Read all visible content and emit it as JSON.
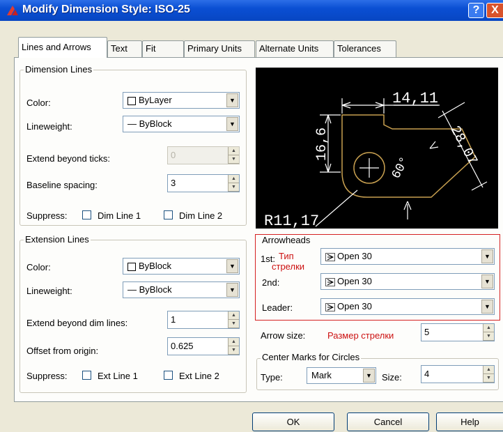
{
  "window": {
    "title": "Modify Dimension Style: ISO-25",
    "help_glyph": "?",
    "close_glyph": "X"
  },
  "tabs": [
    {
      "label": "Lines and Arrows"
    },
    {
      "label": "Text"
    },
    {
      "label": "Fit"
    },
    {
      "label": "Primary Units"
    },
    {
      "label": "Alternate Units"
    },
    {
      "label": "Tolerances"
    }
  ],
  "dimension_lines": {
    "legend": "Dimension Lines",
    "color_label": "Color:",
    "color_value": "ByLayer",
    "lineweight_label": "Lineweight:",
    "lineweight_value": "ByBlock",
    "extend_ticks_label": "Extend beyond ticks:",
    "extend_ticks_value": "0",
    "baseline_label": "Baseline spacing:",
    "baseline_value": "3",
    "suppress_label": "Suppress:",
    "dim1_label": "Dim Line 1",
    "dim2_label": "Dim Line 2"
  },
  "extension_lines": {
    "legend": "Extension Lines",
    "color_label": "Color:",
    "color_value": "ByBlock",
    "lineweight_label": "Lineweight:",
    "lineweight_value": "ByBlock",
    "extend_dim_label": "Extend beyond dim lines:",
    "extend_dim_value": "1",
    "offset_label": "Offset from origin:",
    "offset_value": "0.625",
    "suppress_label": "Suppress:",
    "ext1_label": "Ext Line 1",
    "ext2_label": "Ext Line 2"
  },
  "preview": {
    "dim_top": "14,11",
    "dim_left": "16,6",
    "dim_right": "28,07",
    "angle": "60°",
    "radius": "R11,17"
  },
  "arrowheads": {
    "legend": "Arrowheads",
    "first_label": "1st:",
    "first_value": "Open 30",
    "second_label": "2nd:",
    "second_value": "Open 30",
    "leader_label": "Leader:",
    "leader_value": "Open 30",
    "note_type_line1": "Тип",
    "note_type_line2": "стрелки"
  },
  "arrow_size": {
    "label": "Arrow size:",
    "note": "Размер стрелки",
    "value": "5"
  },
  "center_marks": {
    "legend": "Center Marks for Circles",
    "type_label": "Type:",
    "type_value": "Mark",
    "size_label": "Size:",
    "size_value": "4"
  },
  "buttons": {
    "ok": "OK",
    "cancel": "Cancel",
    "help": "Help"
  },
  "colors": {
    "titlebar": "#0a4fd3",
    "preview_bg": "#000000",
    "preview_geometry": "#c8a050",
    "annotation_red": "#cc1111"
  }
}
